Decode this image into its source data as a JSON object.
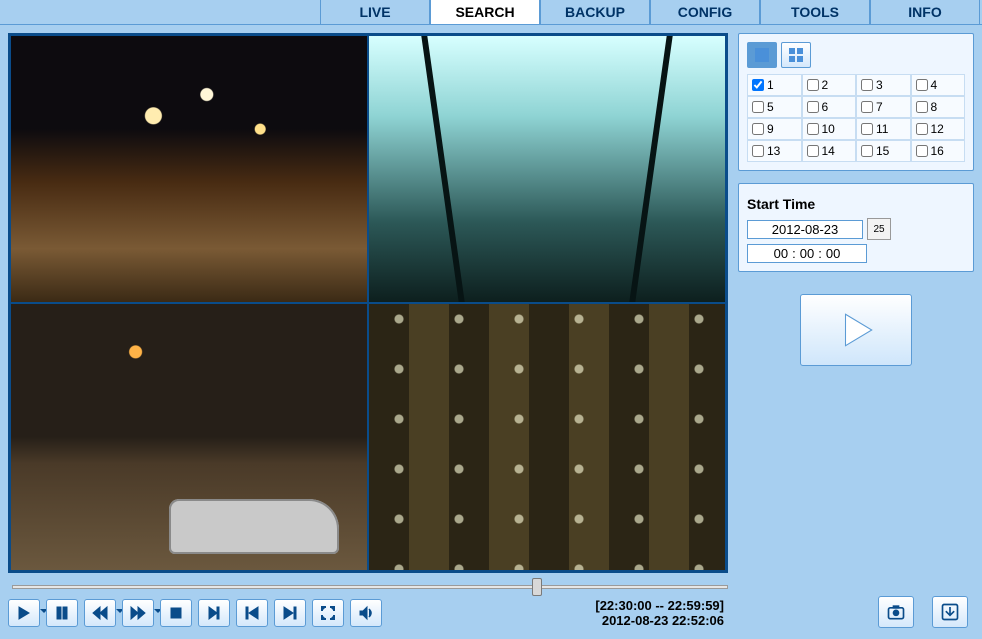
{
  "tabs": {
    "live": "LIVE",
    "search": "SEARCH",
    "backup": "BACKUP",
    "config": "CONFIG",
    "tools": "TOOLS",
    "info": "INFO",
    "active": "search"
  },
  "camera_select": {
    "channels": [
      "1",
      "2",
      "3",
      "4",
      "5",
      "6",
      "7",
      "8",
      "9",
      "10",
      "11",
      "12",
      "13",
      "14",
      "15",
      "16"
    ],
    "checked": [
      true,
      false,
      false,
      false,
      false,
      false,
      false,
      false,
      false,
      false,
      false,
      false,
      false,
      false,
      false,
      false
    ]
  },
  "start_time": {
    "title": "Start Time",
    "date": "2012-08-23",
    "picker_label": "25",
    "hh": "00",
    "mm": "00",
    "ss": "00",
    "sep": ":"
  },
  "timeline": {
    "min": 0,
    "max": 1799,
    "value": 1326,
    "range_label": "[22:30:00 -- 22:59:59]",
    "now_label": "2012-08-23 22:52:06"
  },
  "icons": {
    "play": "play-icon",
    "pause": "pause-icon",
    "rewind": "rewind-icon",
    "fastfwd": "fastfwd-icon",
    "stop": "stop-icon",
    "step": "step-icon",
    "prev": "prev-icon",
    "next": "next-icon",
    "fullscreen": "fullscreen-icon",
    "volume": "volume-icon",
    "snapshot": "camera-icon",
    "download": "download-icon"
  }
}
